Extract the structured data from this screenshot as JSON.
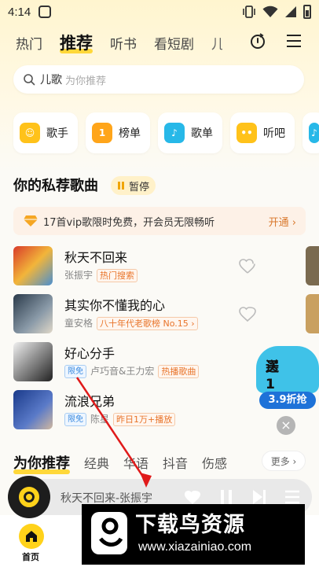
{
  "status_bar": {
    "time": "4:14"
  },
  "top_tabs": [
    "热门",
    "推荐",
    "听书",
    "看短剧",
    "儿"
  ],
  "active_tab": "推荐",
  "search": {
    "keyword": "儿歌",
    "placeholder": "为你推荐"
  },
  "quick_entries": [
    {
      "label": "歌手",
      "icon": "singer-icon",
      "color": "#ffc21a"
    },
    {
      "label": "榜单",
      "icon": "chart-rank-icon",
      "color": "#ffa51a"
    },
    {
      "label": "歌单",
      "icon": "playlist-icon",
      "color": "#27b8e8"
    },
    {
      "label": "听吧",
      "icon": "chat-icon",
      "color": "#ffc21a"
    }
  ],
  "private_section": {
    "title": "你的私荐歌曲",
    "pause_label": "暂停"
  },
  "vip_banner": {
    "text": "17首vip歌限时免费，开会员无限畅听",
    "action": "开通 ›"
  },
  "songs": [
    {
      "title": "秋天不回来",
      "artist": "张振宇",
      "tag": "热门搜索",
      "badge": ""
    },
    {
      "title": "其实你不懂我的心",
      "artist": "童安格",
      "tag": "八十年代老歌榜 No.15 ›",
      "badge": ""
    },
    {
      "title": "好心分手",
      "artist": "卢巧音&王力宏",
      "tag": "热播歌曲",
      "badge": "限免"
    },
    {
      "title": "流浪兄弟",
      "artist": "陈星",
      "tag": "昨日1万+播放",
      "badge": "限免"
    }
  ],
  "promo": {
    "line1": "买1年",
    "line2": "送1年",
    "discount": "3.9折抢"
  },
  "recommend_tabs": [
    "为你推荐",
    "经典",
    "华语",
    "抖音",
    "伤感"
  ],
  "more_label": "更多 ›",
  "player": {
    "now_playing": "秋天不回来-张振宇"
  },
  "bottom_nav": {
    "home_label": "首页"
  },
  "watermark": {
    "title": "下载鸟资源",
    "url": "www.xiazainiao.com"
  }
}
